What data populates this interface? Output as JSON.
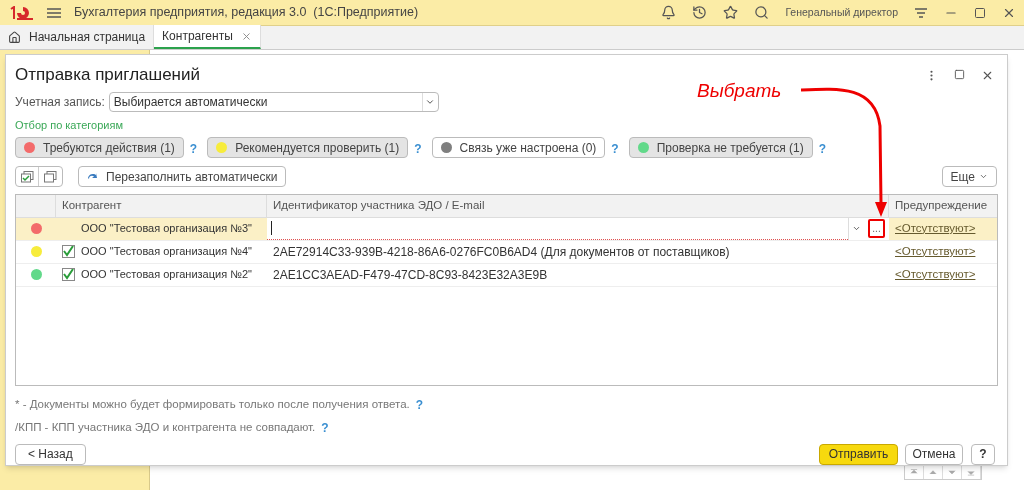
{
  "app": {
    "title": "Бухгалтерия предприятия, редакция 3.0  (1С:Предприятие)",
    "user": "Генеральный директор"
  },
  "tabs": [
    {
      "label": "Начальная страница",
      "selected": false,
      "kind": "home"
    },
    {
      "label": "Контрагенты",
      "selected": true,
      "kind": "closable"
    }
  ],
  "dialog": {
    "title": "Отправка приглашений",
    "account": {
      "label": "Учетная запись:",
      "value": "Выбирается автоматически"
    },
    "filter_title": "Отбор по категориям",
    "filters": [
      {
        "label": "Требуются действия (1)",
        "color": "#f36b6b",
        "selected": true
      },
      {
        "label": "Рекомендуется проверить (1)",
        "color": "#f7ec3c",
        "selected": true
      },
      {
        "label": "Связь уже настроена (0)",
        "color": "#7f7f7f",
        "selected": false
      },
      {
        "label": "Проверка не требуется (1)",
        "color": "#62d98a",
        "selected": true
      }
    ],
    "refill_button": "Перезаполнить автоматически",
    "more_button": "Еще",
    "columns": [
      "Контрагент",
      "Идентификатор участника ЭДО / E-mail",
      "Предупреждение"
    ],
    "rows": [
      {
        "color": "#f36b6b",
        "checked": false,
        "name": "ООО \"Тестовая организация №3\"",
        "editing": true,
        "warning": "<Отсутствуют>",
        "selected": true
      },
      {
        "color": "#f7ec3c",
        "checked": true,
        "name": "ООО \"Тестовая организация №4\"",
        "identifier": "2AE72914C33-939B-4218-86A6-0276FC0B6AD4 (Для документов от поставщиков)",
        "editing": false,
        "warning": "<Отсутствуют>",
        "selected": false
      },
      {
        "color": "#62d98a",
        "checked": true,
        "name": "ООО \"Тестовая организация №2\"",
        "identifier": "2AE1CC3AEAD-F479-47CD-8C93-8423E32A3E9B",
        "editing": false,
        "warning": "<Отсутствуют>",
        "selected": false
      }
    ],
    "notes": [
      "* - Документы можно будет формировать только после получения ответа.",
      "/КПП - КПП участника ЭДО и контрагента не совпадают."
    ],
    "back_button": "< Назад",
    "send_button": "Отправить",
    "cancel_button": "Отмена",
    "help_button": "?",
    "help_mark": "?",
    "select_button": "...",
    "annotation": "Выбрать"
  }
}
